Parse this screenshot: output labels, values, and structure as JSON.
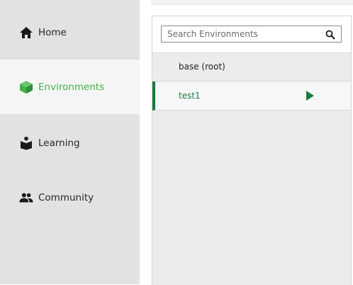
{
  "sidebar": {
    "items": [
      {
        "label": "Home",
        "icon": "home-icon",
        "active": false
      },
      {
        "label": "Environments",
        "icon": "cube-icon",
        "active": true
      },
      {
        "label": "Learning",
        "icon": "book-reader-icon",
        "active": false
      },
      {
        "label": "Community",
        "icon": "people-icon",
        "active": false
      }
    ]
  },
  "environments": {
    "search": {
      "placeholder": "Search Environments",
      "value": "",
      "icon": "search-icon"
    },
    "list": [
      {
        "name": "base (root)",
        "selected": false
      },
      {
        "name": "test1",
        "selected": true,
        "action_icon": "play-icon"
      }
    ]
  },
  "colors": {
    "accent_green": "#43b049",
    "selected_green": "#1a7a3e",
    "sidebar_bg": "#e2e2e2"
  }
}
